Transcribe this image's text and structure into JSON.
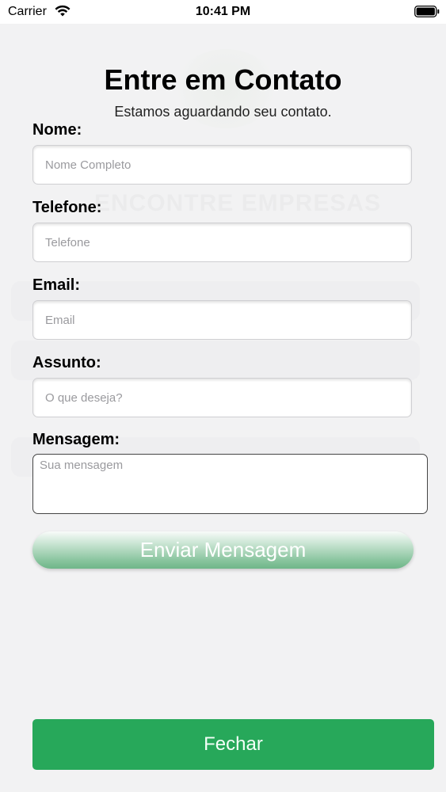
{
  "status_bar": {
    "carrier": "Carrier",
    "time": "10:41 PM",
    "icons": [
      "wifi-icon",
      "battery-icon"
    ]
  },
  "background": {
    "heading": "ENCONTRE EMPRESAS"
  },
  "form": {
    "title": "Entre em Contato",
    "subtitle": "Estamos aguardando seu contato.",
    "fields": {
      "nome": {
        "label": "Nome:",
        "placeholder": "Nome Completo",
        "value": ""
      },
      "telefone": {
        "label": "Telefone:",
        "placeholder": "Telefone",
        "value": ""
      },
      "email": {
        "label": "Email:",
        "placeholder": "Email",
        "value": ""
      },
      "assunto": {
        "label": "Assunto:",
        "placeholder": "O que deseja?",
        "value": ""
      },
      "mensagem": {
        "label": "Mensagem:",
        "placeholder": "Sua mensagem",
        "value": ""
      }
    },
    "send_label": "Enviar Mensagem"
  },
  "close_label": "Fechar",
  "colors": {
    "background": "#f2f2f3",
    "close_button": "#27a85a",
    "send_button_gradient_bottom": "#6fb689"
  }
}
